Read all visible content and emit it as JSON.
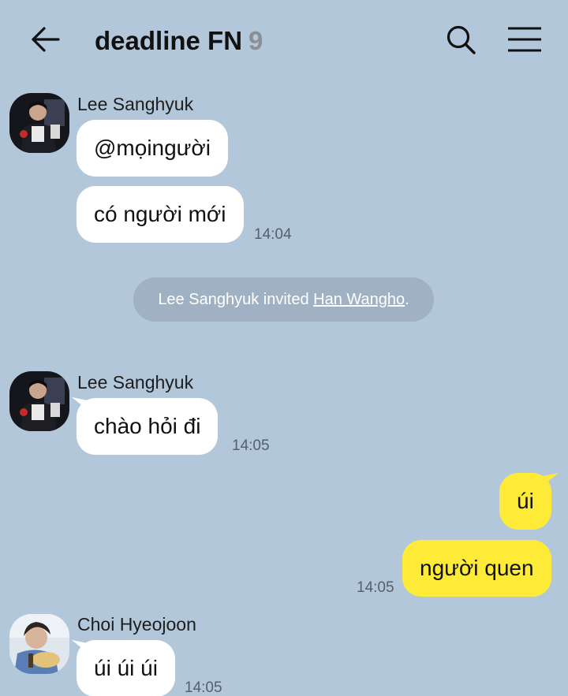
{
  "header": {
    "back_icon": "arrow-left-icon",
    "title": "deadline FN",
    "member_count": "9",
    "search_icon": "search-icon",
    "menu_icon": "hamburger-menu-icon"
  },
  "colors": {
    "background": "#b2c7da",
    "incoming_bubble": "#ffffff",
    "outgoing_bubble": "#fdeb37",
    "system_pill": "#9fb1c2"
  },
  "messages": {
    "block1": {
      "sender": "Lee Sanghyuk",
      "bubble1": "@mọingười",
      "bubble2": "có người mới",
      "time": "14:04"
    },
    "system": {
      "inviter_text": "Lee Sanghyuk invited ",
      "invitee": "Han Wangho",
      "end": "."
    },
    "block2": {
      "sender": "Lee Sanghyuk",
      "bubble1": "chào hỏi đi",
      "time": "14:05"
    },
    "outgoing": {
      "bubble1": "úi",
      "bubble2": "người quen",
      "time": "14:05"
    },
    "block3": {
      "sender": "Choi Hyeojoon",
      "bubble1": "úi úi úi",
      "time": "14:05"
    }
  }
}
